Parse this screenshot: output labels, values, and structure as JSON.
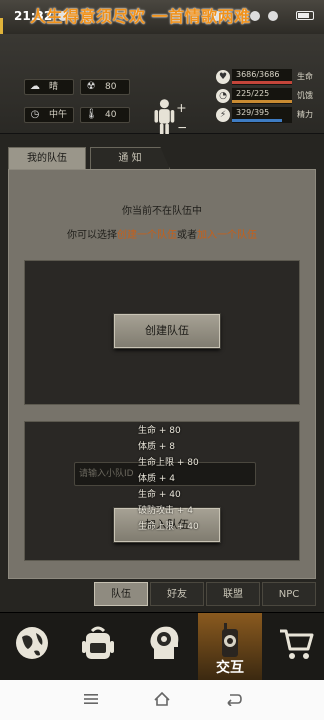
{
  "status_bar": {
    "time": "21:32",
    "banner": "人生得意须尽欢 一首情歌两难"
  },
  "stats": {
    "weather": {
      "icon": "cloud-icon",
      "value": "晴"
    },
    "radiation": {
      "icon": "radiation-icon",
      "value": "80"
    },
    "daytime": {
      "icon": "clock-icon",
      "value": "中午"
    },
    "temperature": {
      "icon": "thermometer-icon",
      "value": "40"
    },
    "health": {
      "value": "3686/3686",
      "label": "生命",
      "fill": 1.0,
      "color": "#c4453a"
    },
    "hunger": {
      "value": "225/225",
      "label": "饥饿",
      "fill": 1.0,
      "color": "#c98b32"
    },
    "energy": {
      "value": "329/395",
      "label": "精力",
      "fill": 0.83,
      "color": "#3e7cc3"
    }
  },
  "tabs": {
    "my_team": "我的队伍",
    "notice": "通  知"
  },
  "team": {
    "not_in_team": "你当前不在队伍中",
    "choose_prefix": "你可以选择",
    "create_link": "创建一个队伍",
    "or": "或者",
    "join_link": "加入一个队伍",
    "create_button": "创建队伍",
    "input_placeholder": "请输入小队ID",
    "join_button": "加入队伍"
  },
  "floating_bonuses": [
    "生命 + 80",
    "体质 + 8",
    "生命上限 + 80",
    "体质 + 4",
    "生命 + 40",
    "破防攻击 + 4",
    "生命上限 + 40"
  ],
  "sub_tabs": [
    "队伍",
    "好友",
    "联盟",
    "NPC"
  ],
  "bottom_nav": {
    "active_label": "交互"
  }
}
